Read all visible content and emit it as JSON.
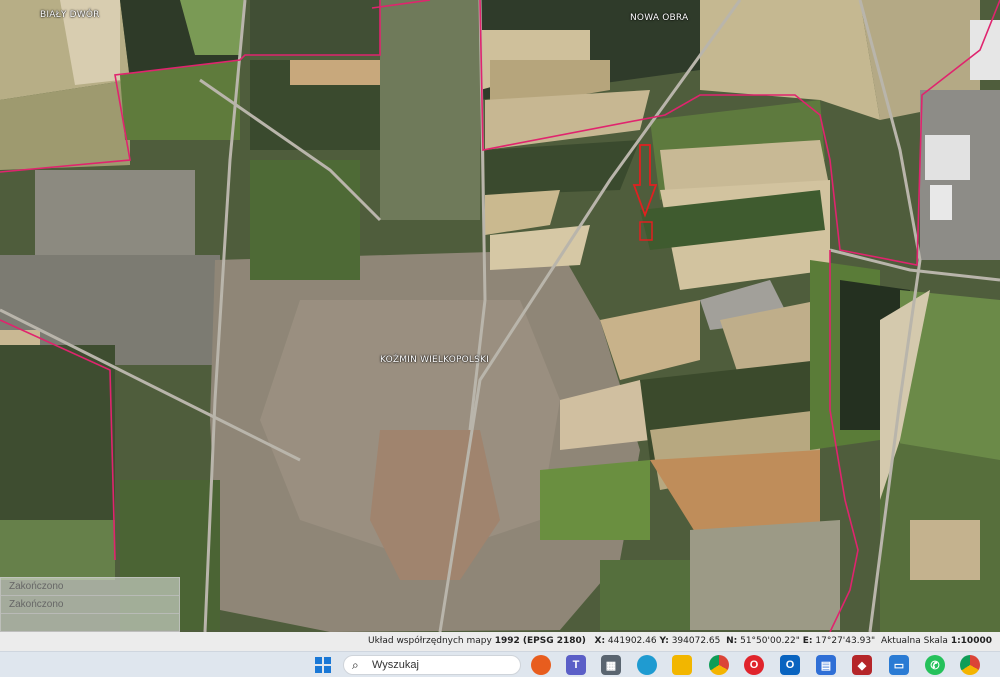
{
  "map": {
    "labels": {
      "bialy_dwor": "BIAŁY DWÓR",
      "nowa_obra": "NOWA OBRA",
      "kozmin": "KOŹMIN WIELKOPOLSKI"
    },
    "colors": {
      "parcel_boundary": "#e0246e",
      "marker_arrow": "#e02020",
      "field_green": "#5c7a3a",
      "field_tan": "#c7b98f",
      "urban": "#8a8478"
    }
  },
  "status_panel": {
    "rows": [
      "Zakończono",
      "Zakończono",
      ""
    ]
  },
  "coord_bar": {
    "system_label": "Układ współrzędnych mapy",
    "system_value": "1992 (EPSG 2180)",
    "x_label": "X:",
    "x_value": "441902.46",
    "y_label": "Y:",
    "y_value": "394072.65",
    "n_label": "N:",
    "n_value": "51°50'00.22\"",
    "e_label": "E:",
    "e_value": "17°27'43.93\"",
    "scale_label": "Aktualna Skala",
    "scale_value": "1:10000"
  },
  "taskbar": {
    "search_placeholder": "Wyszukaj",
    "icons": [
      "windows-start",
      "search",
      "firefox",
      "teams",
      "calculator",
      "edge",
      "file-explorer",
      "chrome",
      "opera",
      "outlook",
      "store",
      "app-red",
      "app-blue",
      "whatsapp",
      "chrome-profile"
    ]
  }
}
